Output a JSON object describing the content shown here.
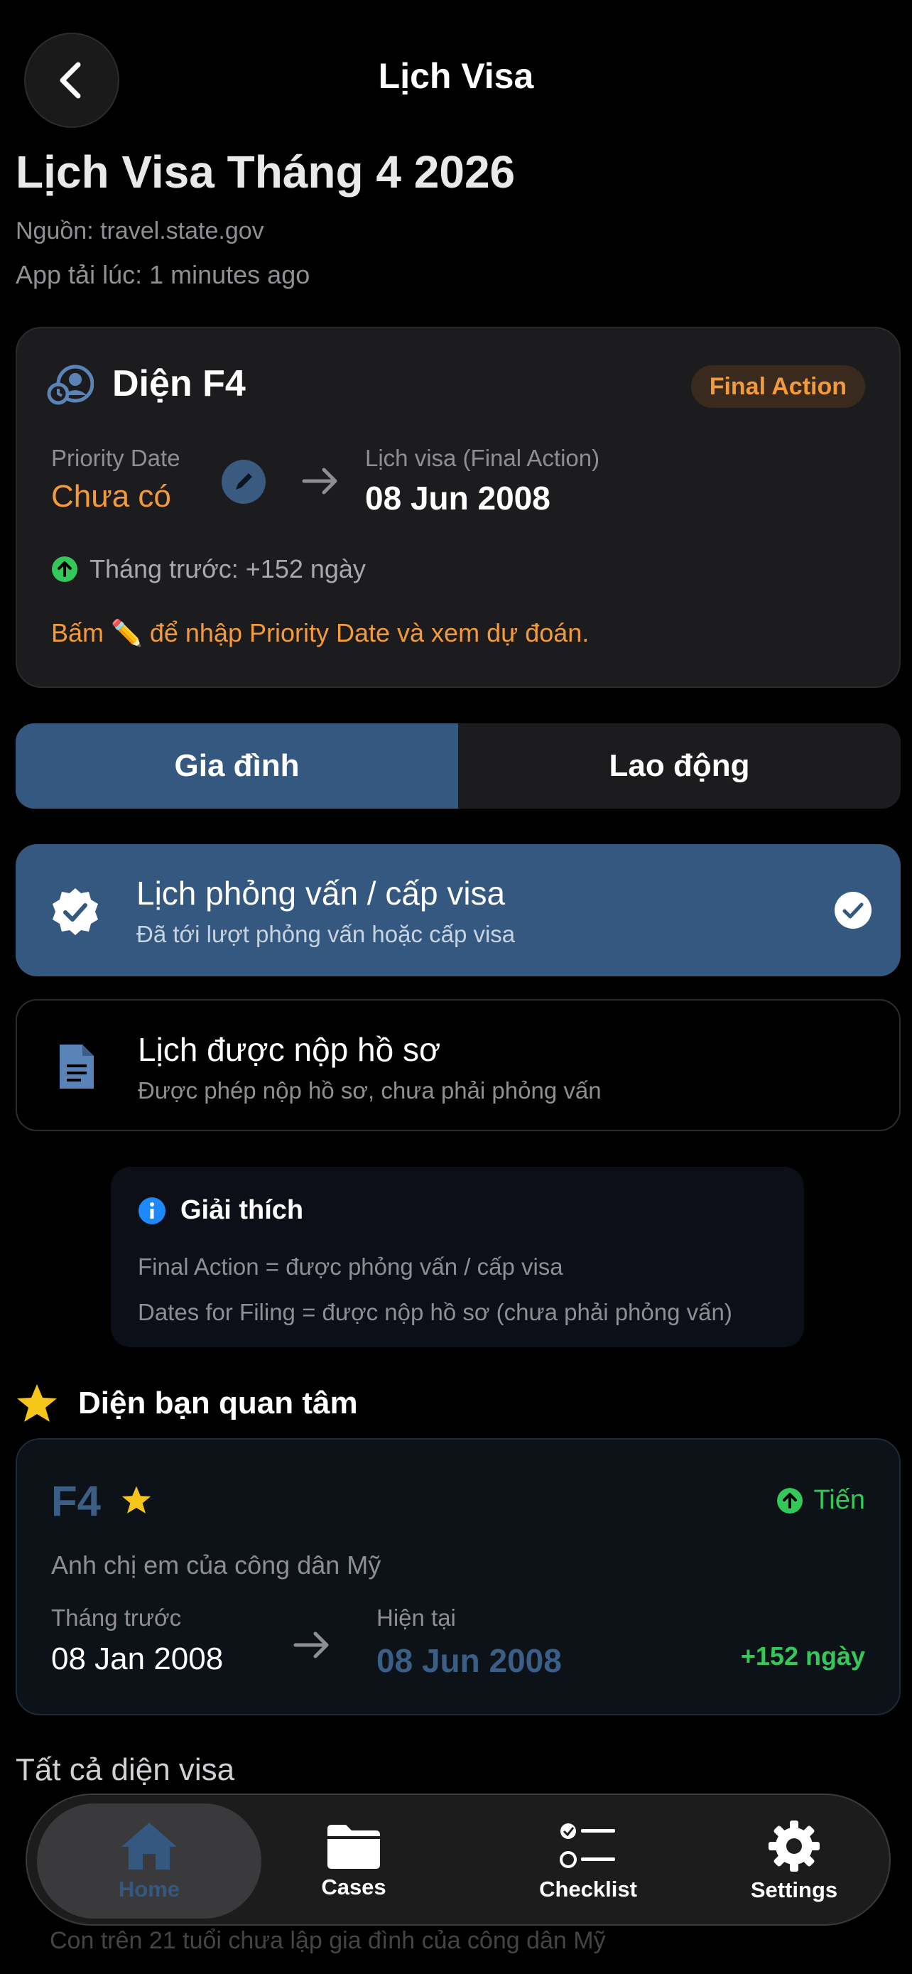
{
  "header": {
    "title": "Lịch Visa"
  },
  "page": {
    "title": "Lịch Visa Tháng 4 2026",
    "source": "Nguồn: travel.state.gov",
    "fetched": "App tải lúc: 1 minutes ago"
  },
  "summary": {
    "category": "Diện F4",
    "badge": "Final Action",
    "priority_label": "Priority Date",
    "priority_value": "Chưa có",
    "final_label": "Lịch visa (Final Action)",
    "final_value": "08 Jun 2008",
    "prev_month": "Tháng trước: +152 ngày",
    "hint": "Bấm ✏️ để nhập Priority Date và xem dự đoán."
  },
  "segments": [
    "Gia đình",
    "Lao động"
  ],
  "options": [
    {
      "title": "Lịch phỏng vấn / cấp visa",
      "subtitle": "Đã tới lượt phỏng vấn hoặc cấp visa"
    },
    {
      "title": "Lịch được nộp hồ sơ",
      "subtitle": "Được phép nộp hồ sơ, chưa phải phỏng vấn"
    }
  ],
  "explain": {
    "title": "Giải thích",
    "line1": "Final Action = được phỏng vấn / cấp visa",
    "line2": "Dates for Filing = được nộp hồ sơ (chưa phải phỏng vấn)"
  },
  "favorites": {
    "heading": "Diện bạn quan tâm",
    "card": {
      "code": "F4",
      "trend": "Tiến",
      "description": "Anh chị em của công dân Mỹ",
      "prev_label": "Tháng trước",
      "prev_value": "08 Jan 2008",
      "cur_label": "Hiện tại",
      "cur_value": "08 Jun 2008",
      "diff": "+152 ngày"
    }
  },
  "all": {
    "heading": "Tất cả diện visa",
    "peek_text": "Con trên 21 tuổi chưa lập gia đình của công dân Mỹ"
  },
  "tabbar": [
    "Home",
    "Cases",
    "Checklist",
    "Settings"
  ],
  "colors": {
    "accent": "#34587f",
    "orange": "#f39a3b",
    "green": "#34c759",
    "star": "#f5c518"
  }
}
